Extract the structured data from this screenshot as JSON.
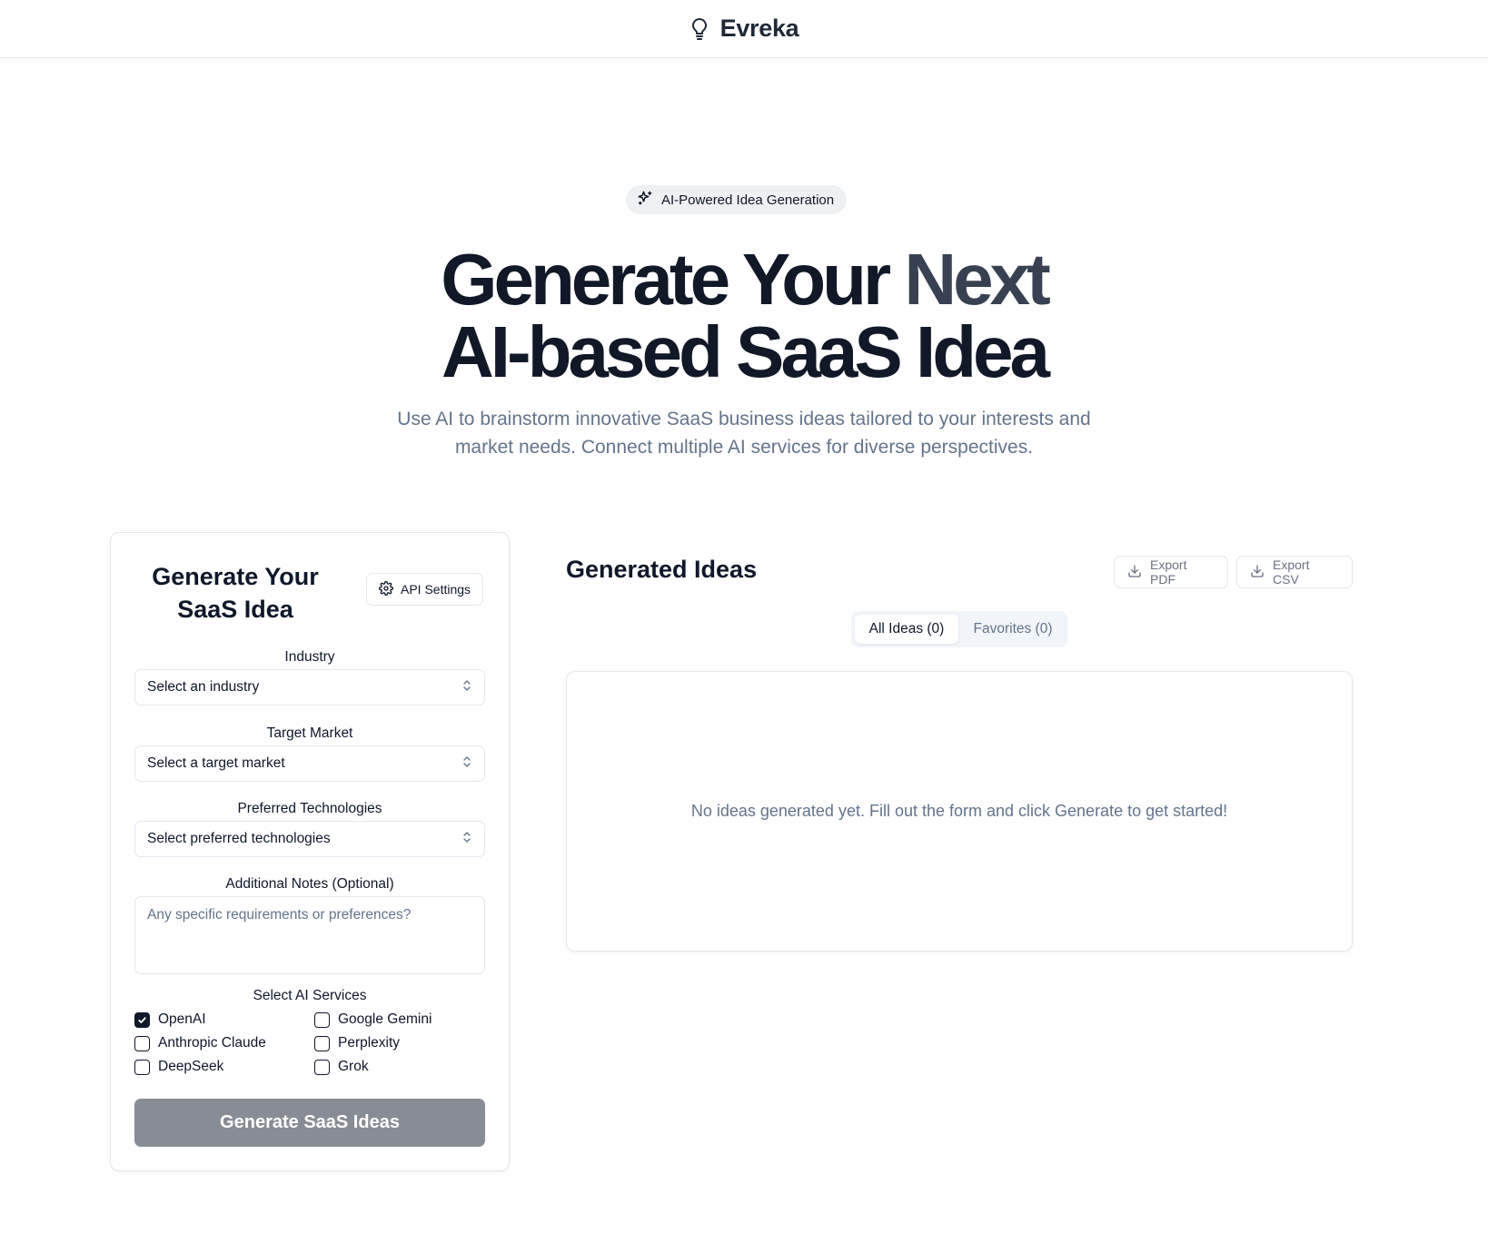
{
  "header": {
    "brand_name": "Evreka",
    "logo_icon": "lightbulb-icon"
  },
  "hero": {
    "badge_label": "AI-Powered Idea Generation",
    "badge_icon": "sparkles-icon",
    "title_line1_part1": "Generate Your ",
    "title_line1_part2": "Next",
    "title_line2": "AI-based SaaS Idea",
    "subtitle": "Use AI to brainstorm innovative SaaS business ideas tailored to your interests and market needs. Connect multiple AI services for diverse perspectives."
  },
  "form": {
    "title": "Generate Your SaaS Idea",
    "api_settings_label": "API Settings",
    "industry": {
      "label": "Industry",
      "value": "Select an industry"
    },
    "target_market": {
      "label": "Target Market",
      "value": "Select a target market"
    },
    "technologies": {
      "label": "Preferred Technologies",
      "value": "Select preferred technologies"
    },
    "notes": {
      "label": "Additional Notes (Optional)",
      "placeholder": "Any specific requirements or preferences?"
    },
    "services_label": "Select AI Services",
    "services": [
      {
        "label": "OpenAI",
        "checked": true
      },
      {
        "label": "Google Gemini",
        "checked": false
      },
      {
        "label": "Anthropic Claude",
        "checked": false
      },
      {
        "label": "Perplexity",
        "checked": false
      },
      {
        "label": "DeepSeek",
        "checked": false
      },
      {
        "label": "Grok",
        "checked": false
      }
    ],
    "generate_label": "Generate SaaS Ideas"
  },
  "results": {
    "title": "Generated Ideas",
    "export_pdf_label": "Export PDF",
    "export_csv_label": "Export CSV",
    "tabs": [
      {
        "label": "All Ideas (0)",
        "active": true
      },
      {
        "label": "Favorites (0)",
        "active": false
      }
    ],
    "empty_message": "No ideas generated yet. Fill out the form and click Generate to get started!"
  },
  "colors": {
    "primary_text": "#0f172a",
    "muted_text": "#64748b",
    "disabled_button": "#888c94",
    "border": "#e5e7eb"
  }
}
